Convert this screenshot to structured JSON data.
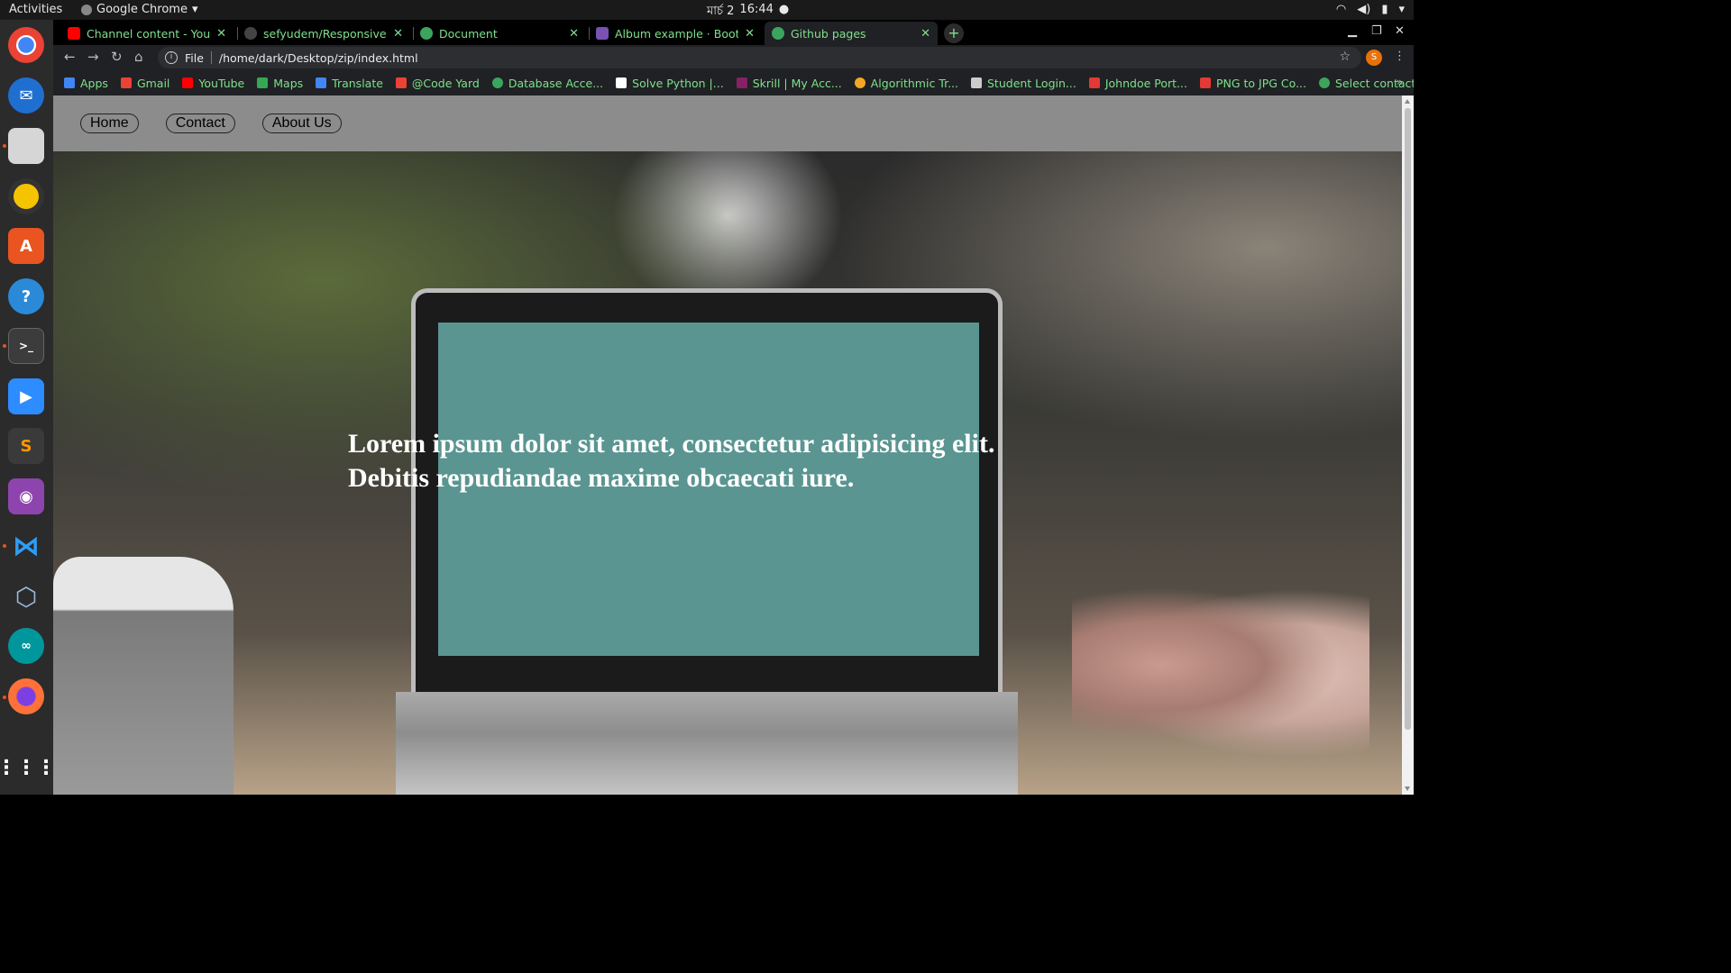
{
  "topbar": {
    "activities": "Activities",
    "app_name": "Google Chrome",
    "date": "মার্চ 2",
    "time": "16:44"
  },
  "dock": {
    "items": [
      "chrome",
      "thunderbird",
      "files",
      "rhythmbox",
      "software-center",
      "help",
      "terminal",
      "zoom",
      "sublime-text",
      "screen-recorder",
      "vscode",
      "virtualbox",
      "arduino",
      "firefox",
      "show-apps"
    ]
  },
  "tabs": [
    {
      "title": "Channel content - YouTube",
      "favicon_color": "#ff0000"
    },
    {
      "title": "sefyudem/Responsive-Lo",
      "favicon_color": "#333333"
    },
    {
      "title": "Document",
      "favicon_color": "#3ba55d",
      "active": true
    },
    {
      "title": "Album example · Bootstrap",
      "favicon_color": "#7952b3"
    },
    {
      "title": "Github pages",
      "favicon_color": "#3ba55d"
    }
  ],
  "toolbar": {
    "scheme": "File",
    "url": "/home/dark/Desktop/zip/index.html",
    "profile_initial": "S"
  },
  "bookmarks": [
    {
      "label": "Apps",
      "color": "#4285f4"
    },
    {
      "label": "Gmail",
      "color": "#ea4335"
    },
    {
      "label": "YouTube",
      "color": "#ff0000"
    },
    {
      "label": "Maps",
      "color": "#34a853"
    },
    {
      "label": "Translate",
      "color": "#4285f4"
    },
    {
      "label": "@Code Yard",
      "color": "#ea4335"
    },
    {
      "label": "Database Acce...",
      "color": "#3ba55d"
    },
    {
      "label": "Solve Python |...",
      "color": "#ffffff"
    },
    {
      "label": "Skrill | My Acc...",
      "color": "#862165"
    },
    {
      "label": "Algorithmic Tr...",
      "color": "#f5a623"
    },
    {
      "label": "Student Login...",
      "color": "#cccccc"
    },
    {
      "label": "Johndoe Port...",
      "color": "#e53935"
    },
    {
      "label": "PNG to JPG Co...",
      "color": "#e53935"
    },
    {
      "label": "Select contact...",
      "color": "#3ba55d"
    }
  ],
  "site": {
    "nav": [
      "Home",
      "Contact",
      "About Us"
    ],
    "hero_text": "Lorem ipsum dolor sit amet, consectetur adipisicing elit. Debitis repudiandae maxime obcaecati iure."
  }
}
